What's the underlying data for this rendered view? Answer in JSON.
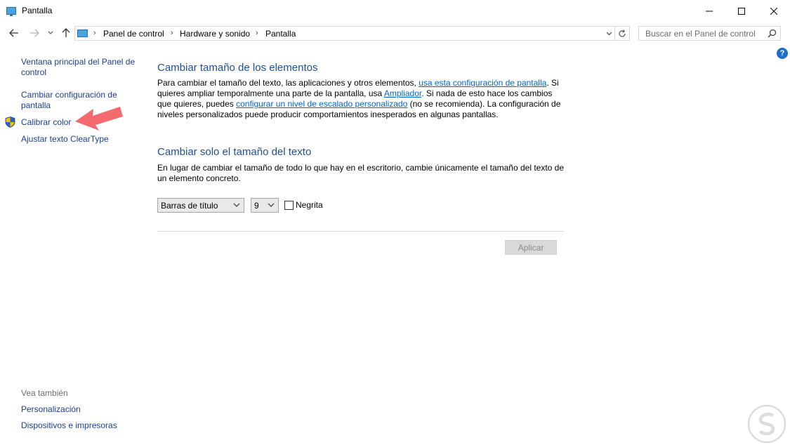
{
  "window": {
    "title": "Pantalla",
    "minimize_label": "Minimizar",
    "maximize_label": "Maximizar",
    "close_label": "Cerrar"
  },
  "address": {
    "breadcrumbs": [
      "Panel de control",
      "Hardware y sonido",
      "Pantalla"
    ]
  },
  "search": {
    "placeholder": "Buscar en el Panel de control"
  },
  "help": {
    "label": "?"
  },
  "sidebar": {
    "items": [
      {
        "label_line1": "Ventana principal del Panel de",
        "label_line2": "control"
      },
      {
        "label_line1": "Cambiar configuración de",
        "label_line2": "pantalla"
      },
      {
        "label": "Calibrar color",
        "icon": "uac-shield-icon"
      },
      {
        "label": "Ajustar texto ClearType"
      }
    ],
    "see_also_title": "Vea también",
    "see_also": [
      "Personalización",
      "Dispositivos e impresoras"
    ]
  },
  "main": {
    "section1": {
      "heading": "Cambiar tamaño de los elementos",
      "p1_a": "Para cambiar el tamaño del texto, las aplicaciones y otros elementos, ",
      "p1_link1": "usa esta configuración de pantalla",
      "p1_b": ". Si quieres ampliar temporalmente una parte de la pantalla, usa ",
      "p1_link2": "Ampliador",
      "p1_c": ". Si nada de esto hace los cambios que quieres, puedes ",
      "p1_link3": "configurar un nivel de escalado personalizado",
      "p1_d": " (no se recomienda). La configuración de niveles personalizados puede producir comportamientos inesperados en algunas pantallas."
    },
    "section2": {
      "heading": "Cambiar solo el tamaño del texto",
      "paragraph": "En lugar de cambiar el tamaño de todo lo que hay en el escritorio, cambie únicamente el tamaño del texto de un elemento concreto.",
      "element_select": "Barras de título",
      "size_select": "9",
      "bold_label": "Negrita",
      "bold_checked": false
    },
    "apply_label": "Aplicar"
  },
  "colors": {
    "link": "#1a3f8f",
    "heading": "#1e4f91",
    "inline_link": "#0066cc",
    "annotation_arrow": "#f46a6f"
  }
}
